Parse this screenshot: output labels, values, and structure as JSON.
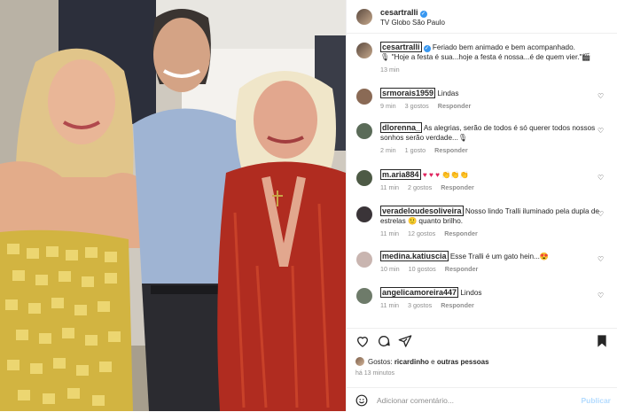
{
  "post": {
    "username": "cesartralli",
    "location": "TV Globo São Paulo"
  },
  "caption": {
    "username": "cesartralli",
    "text_line1": "Feriado bem animado e bem acompanhado.",
    "text_line2": "\"Hoje a festa é sua...hoje a festa é nossa...é de quem vier.\"",
    "time": "13 min"
  },
  "comments": [
    {
      "username": "srmorais1959",
      "text": "Lindas",
      "time": "9 min",
      "likes": "3 gostos",
      "reply": "Responder",
      "avatar_color": "#8a6a55"
    },
    {
      "username": "dlorenna_",
      "text": "As alegrias, serão de todos é só querer todos nossos sonhos serão verdade...",
      "time": "2 min",
      "likes": "1 gosto",
      "reply": "Responder",
      "avatar_color": "#5a6b58"
    },
    {
      "username": "m.aria884",
      "text": "♥ ♥ ♥ 👏👏👏",
      "time": "11 min",
      "likes": "2 gostos",
      "reply": "Responder",
      "avatar_color": "#4d5a45"
    },
    {
      "username": "veradeloudesoliveira",
      "text": "Nosso lindo Tralli iluminado pela dupla de estrelas 🙂 quanto brilho.",
      "time": "11 min",
      "likes": "12 gostos",
      "reply": "Responder",
      "avatar_color": "#3a3438"
    },
    {
      "username": "medina.katiuscia",
      "text": "Esse Tralli é um gato hein...😍",
      "time": "10 min",
      "likes": "10 gostos",
      "reply": "Responder",
      "avatar_color": "#c9b5b0"
    },
    {
      "username": "angelicamoreira447",
      "text": "Lindos",
      "time": "11 min",
      "likes": "3 gostos",
      "reply": "Responder",
      "avatar_color": "#6e7b6a"
    }
  ],
  "likes": {
    "prefix": "Gostos:",
    "user": "ricardinho",
    "connector": "e",
    "others": "outras pessoas"
  },
  "time_ago": "há 13 minutos",
  "add_comment": {
    "placeholder": "Adicionar comentário...",
    "publish": "Publicar"
  },
  "icons": [
    "heart-icon",
    "comment-icon",
    "share-icon",
    "bookmark-icon",
    "emoji-icon"
  ],
  "colors": {
    "verified": "#3897f0",
    "publish": "#b3dbff",
    "text": "#262626",
    "muted": "#8e8e8e"
  }
}
